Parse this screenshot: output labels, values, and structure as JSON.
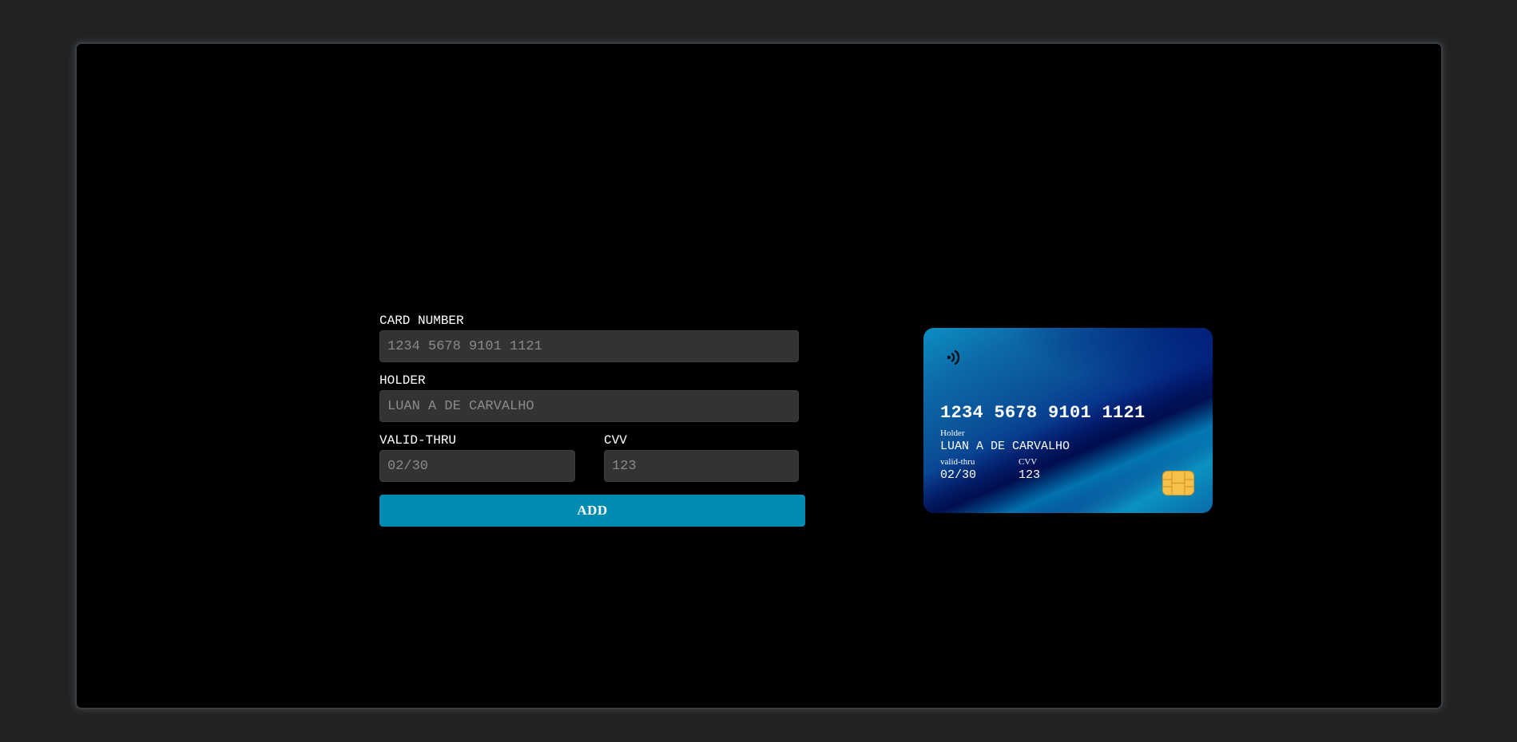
{
  "form": {
    "card_number": {
      "label": "CARD NUMBER",
      "placeholder": "1234 5678 9101 1121",
      "value": ""
    },
    "holder": {
      "label": "HOLDER",
      "placeholder": "LUAN A DE CARVALHO",
      "value": ""
    },
    "valid_thru": {
      "label": "VALID-THRU",
      "placeholder": "02/30",
      "value": ""
    },
    "cvv": {
      "label": "CVV",
      "placeholder": "123",
      "value": ""
    },
    "add_button_label": "ADD"
  },
  "card": {
    "number": "1234 5678 9101 1121",
    "holder_label": "Holder",
    "holder_name": "LUAN A DE CARVALHO",
    "valid_thru_label": "valid-thru",
    "valid_thru": "02/30",
    "cvv_label": "CVV",
    "cvv": "123",
    "contactless_icon": "contactless-icon",
    "chip_icon": "chip-icon"
  },
  "colors": {
    "page_background": "#222222",
    "panel_background": "#000000",
    "input_background": "#333333",
    "button_accent": "#008bb3",
    "chip_gold": "#f6c04c"
  }
}
